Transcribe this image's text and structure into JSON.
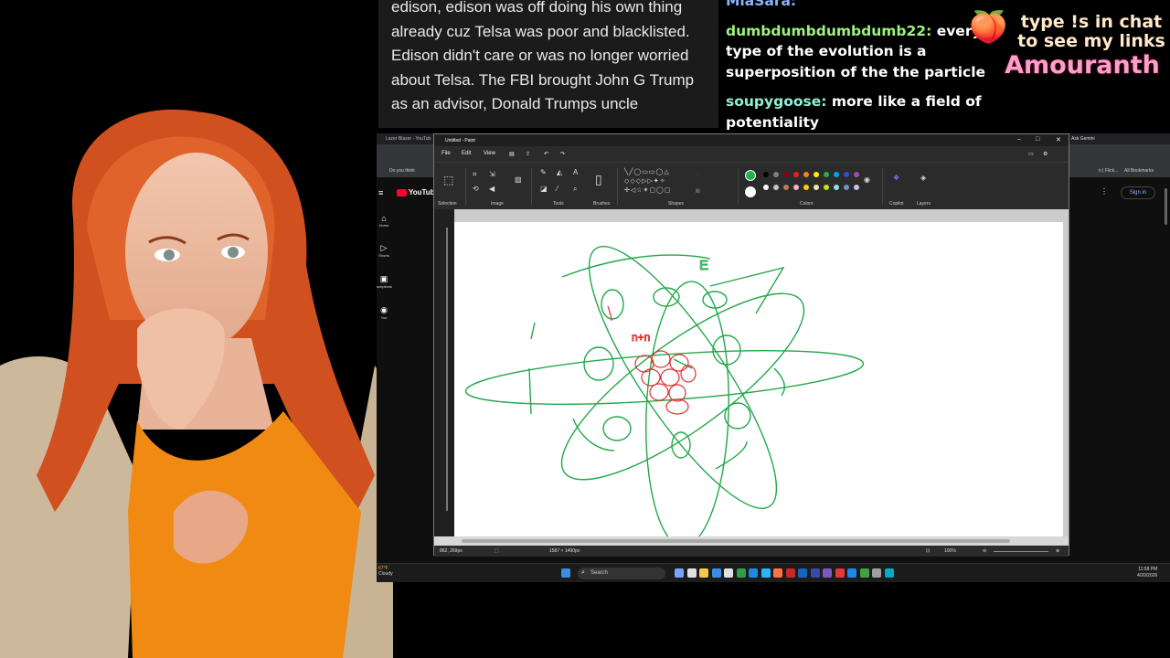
{
  "caption": {
    "text": "edison, edison was off doing his own thing already cuz Telsa was poor and blacklisted. Edison didn't care or was no longer worried about Telsa. The FBI brought John G Trump as an advisor, Donald Trumps uncle"
  },
  "chat": {
    "messages": [
      {
        "user": "MiaSara:",
        "text": "",
        "color": "#8ab4ff"
      },
      {
        "user": "dumbdumbdumbdumb22:",
        "text": "every type of the evolution is a superposition of the the particle",
        "color": "#9ef27e"
      },
      {
        "user": "soupygoose:",
        "text": "more like a field of potentiality",
        "color": "#8ef0d6"
      }
    ]
  },
  "brand": {
    "tagline": "type !s in chat to see my links",
    "name": "Amouranth",
    "peach_icon": "peach-icon"
  },
  "browser": {
    "tab_title": "Lazer Blazer - YouTub",
    "right_tab": "Ask Gemini",
    "bookmark_left": "Do you think",
    "bookmark_right1": "n | Flick...",
    "bookmark_right2": "All Bookmarks",
    "logo": "YouTube",
    "sign_in": "Sign in",
    "nav": [
      {
        "label": "Home",
        "icon": "home-icon"
      },
      {
        "label": "Shorts",
        "icon": "shorts-icon"
      },
      {
        "label": "scriptions",
        "icon": "subscriptions-icon"
      },
      {
        "label": "You",
        "icon": "you-icon"
      }
    ]
  },
  "paint": {
    "title": "Untitled - Paint",
    "menu": {
      "file": "File",
      "edit": "Edit",
      "view": "View"
    },
    "groups": {
      "selection": "Selection",
      "image": "Image",
      "tools": "Tools",
      "brushes": "Brushes",
      "shapes": "Shapes",
      "colors": "Colors",
      "copilot": "Copilot",
      "layers": "Layers"
    },
    "palette": [
      "#000000",
      "#7f7f7f",
      "#880015",
      "#ed1c24",
      "#ff7f27",
      "#fff200",
      "#22b14c",
      "#00a2e8",
      "#3f48cc",
      "#a349a4",
      "#ffffff",
      "#c3c3c3",
      "#b97a57",
      "#ffaec9",
      "#ffc90e",
      "#efe4b0",
      "#b5e61d",
      "#99d9ea",
      "#7092be",
      "#c8bfe7"
    ],
    "active_color": "#22b14c",
    "status": {
      "cursor": "862, 269px",
      "size": "1587 × 1490px",
      "zoom": "100%"
    },
    "drawing": {
      "label_e": "E",
      "label_n": "n+n"
    }
  },
  "taskbar": {
    "temp": "67°F",
    "weather": "Cloudy",
    "search": "Search",
    "time": "11:58 PM",
    "date": "4/20/2026"
  }
}
